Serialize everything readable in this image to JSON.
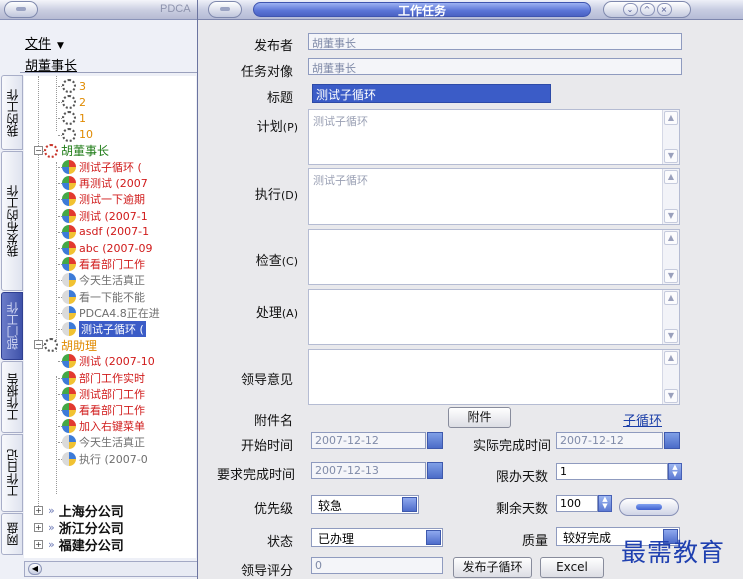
{
  "back_window": {
    "title": "PDCA",
    "menu_file": "文件",
    "user": "胡董事长",
    "tabs": [
      "我的工作",
      "我发布的工作",
      "部门工作",
      "工作报告",
      "工作日记",
      "网盘"
    ],
    "active_tab": "部门工作",
    "tree": [
      {
        "label": "3",
        "color": "orange",
        "icon": "loop",
        "depth": 2
      },
      {
        "label": "2",
        "color": "orange",
        "icon": "loop",
        "depth": 2
      },
      {
        "label": "1",
        "color": "orange",
        "icon": "loop",
        "depth": 2
      },
      {
        "label": "10",
        "color": "orange",
        "icon": "loop",
        "depth": 2
      },
      {
        "label": "胡董事长",
        "color": "green",
        "icon": "loop-red",
        "depth": 1
      },
      {
        "label": "测试子循环 (",
        "color": "red",
        "icon": "ball",
        "depth": 2
      },
      {
        "label": "再测试 (2007",
        "color": "red",
        "icon": "ball",
        "depth": 2
      },
      {
        "label": "测试一下逾期",
        "color": "red",
        "icon": "ball",
        "depth": 2
      },
      {
        "label": "测试 (2007-1",
        "color": "red",
        "icon": "ball",
        "depth": 2
      },
      {
        "label": "asdf (2007-1",
        "color": "red",
        "icon": "ball",
        "depth": 2
      },
      {
        "label": "abc (2007-09",
        "color": "red",
        "icon": "ball",
        "depth": 2
      },
      {
        "label": "看看部门工作",
        "color": "red",
        "icon": "ball",
        "depth": 2
      },
      {
        "label": "今天生活真正",
        "color": "grey",
        "icon": "ball-half",
        "depth": 2
      },
      {
        "label": "看一下能不能",
        "color": "grey",
        "icon": "ball-half",
        "depth": 2
      },
      {
        "label": "PDCA4.8正在进",
        "color": "grey",
        "icon": "ball-half",
        "depth": 2
      },
      {
        "label": "测试子循环 (",
        "color": "selected",
        "icon": "ball-half",
        "depth": 2
      },
      {
        "label": "胡助理",
        "color": "orange",
        "icon": "loop",
        "depth": 1
      },
      {
        "label": "测试 (2007-10",
        "color": "red",
        "icon": "ball",
        "depth": 2
      },
      {
        "label": "部门工作实时",
        "color": "red",
        "icon": "ball",
        "depth": 2
      },
      {
        "label": "测试部门工作",
        "color": "red",
        "icon": "ball",
        "depth": 2
      },
      {
        "label": "看看部门工作",
        "color": "red",
        "icon": "ball",
        "depth": 2
      },
      {
        "label": "加入右键菜单",
        "color": "red",
        "icon": "ball",
        "depth": 2
      },
      {
        "label": "今天生活真正",
        "color": "grey",
        "icon": "ball-half",
        "depth": 2
      },
      {
        "label": "执行 (2007-0",
        "color": "grey",
        "icon": "ball-half",
        "depth": 2
      }
    ],
    "branches": [
      "上海分公司",
      "浙江分公司",
      "福建分公司"
    ]
  },
  "dialog": {
    "title": "工作任务",
    "labels": {
      "publisher": "发布者",
      "target": "任务对像",
      "subject": "标题",
      "plan": "计划",
      "plan_key": "(P)",
      "do": "执行",
      "do_key": "(D)",
      "check": "检查",
      "check_key": "(C)",
      "act": "处理",
      "act_key": "(A)",
      "leader_opinion": "领导意见",
      "attachment": "附件名",
      "start_time": "开始时间",
      "actual_finish": "实际完成时间",
      "required_finish": "要求完成时间",
      "limit_days": "限办天数",
      "priority": "优先级",
      "remain_days": "剩余天数",
      "status": "状态",
      "quality": "质量",
      "leader_score": "领导评分"
    },
    "values": {
      "publisher": "胡董事长",
      "target": "胡董事长",
      "subject": "测试子循环",
      "plan": "测试子循环",
      "do": "测试子循环",
      "start_time": "2007-12-12",
      "actual_finish": "2007-12-12",
      "required_finish": "2007-12-13",
      "limit_days": "1",
      "priority": "较急",
      "remain_days": "100",
      "status": "已办理",
      "quality": "较好完成",
      "leader_score": "0"
    },
    "buttons": {
      "attachment": "附件",
      "sub_loop_link": "子循环",
      "publish_sub_loop": "发布子循环",
      "excel": "Excel"
    },
    "colors": {
      "accent": "#3b5cc7",
      "red_item": "#d01b1b",
      "link": "#1a3ea8"
    }
  },
  "watermark": "最需教育"
}
